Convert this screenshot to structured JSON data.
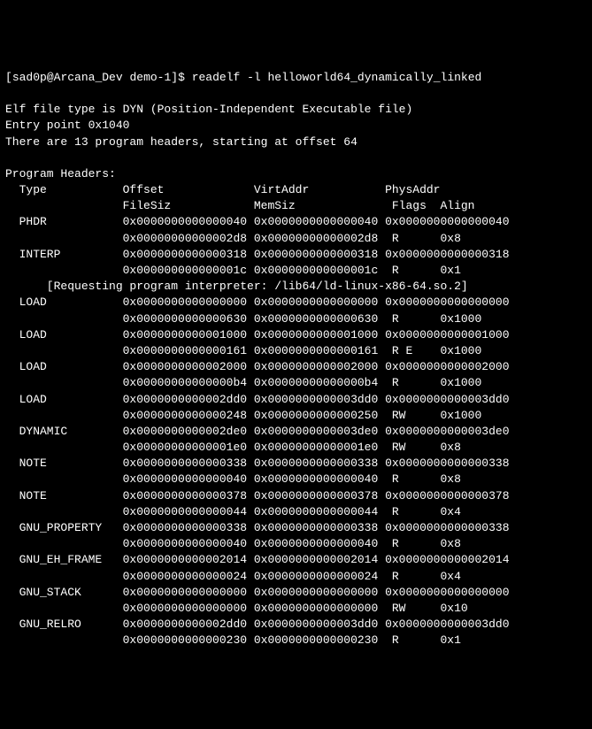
{
  "prompt": {
    "user": "sad0p",
    "host": "Arcana_Dev",
    "cwd": "demo-1",
    "command": "readelf -l helloworld64_dynamically_linked"
  },
  "header": {
    "filetype": "Elf file type is DYN (Position-Independent Executable file)",
    "entrypoint": "Entry point 0x1040",
    "count": "There are 13 program headers, starting at offset 64"
  },
  "section_title": "Program Headers:",
  "columns": {
    "type": "Type",
    "offset": "Offset",
    "virtaddr": "VirtAddr",
    "physaddr": "PhysAddr",
    "filesiz": "FileSiz",
    "memsiz": "MemSiz",
    "flags": "Flags",
    "align": "Align"
  },
  "interpreter_note": "[Requesting program interpreter: /lib64/ld-linux-x86-64.so.2]",
  "rows": [
    {
      "type": "PHDR",
      "offset": "0x0000000000000040",
      "virtaddr": "0x0000000000000040",
      "physaddr": "0x0000000000000040",
      "filesiz": "0x00000000000002d8",
      "memsiz": "0x00000000000002d8",
      "flags": "R",
      "align": "0x8"
    },
    {
      "type": "INTERP",
      "offset": "0x0000000000000318",
      "virtaddr": "0x0000000000000318",
      "physaddr": "0x0000000000000318",
      "filesiz": "0x000000000000001c",
      "memsiz": "0x000000000000001c",
      "flags": "R",
      "align": "0x1"
    },
    {
      "type": "LOAD",
      "offset": "0x0000000000000000",
      "virtaddr": "0x0000000000000000",
      "physaddr": "0x0000000000000000",
      "filesiz": "0x0000000000000630",
      "memsiz": "0x0000000000000630",
      "flags": "R",
      "align": "0x1000"
    },
    {
      "type": "LOAD",
      "offset": "0x0000000000001000",
      "virtaddr": "0x0000000000001000",
      "physaddr": "0x0000000000001000",
      "filesiz": "0x0000000000000161",
      "memsiz": "0x0000000000000161",
      "flags": "R E",
      "align": "0x1000"
    },
    {
      "type": "LOAD",
      "offset": "0x0000000000002000",
      "virtaddr": "0x0000000000002000",
      "physaddr": "0x0000000000002000",
      "filesiz": "0x00000000000000b4",
      "memsiz": "0x00000000000000b4",
      "flags": "R",
      "align": "0x1000"
    },
    {
      "type": "LOAD",
      "offset": "0x0000000000002dd0",
      "virtaddr": "0x0000000000003dd0",
      "physaddr": "0x0000000000003dd0",
      "filesiz": "0x0000000000000248",
      "memsiz": "0x0000000000000250",
      "flags": "RW",
      "align": "0x1000"
    },
    {
      "type": "DYNAMIC",
      "offset": "0x0000000000002de0",
      "virtaddr": "0x0000000000003de0",
      "physaddr": "0x0000000000003de0",
      "filesiz": "0x00000000000001e0",
      "memsiz": "0x00000000000001e0",
      "flags": "RW",
      "align": "0x8"
    },
    {
      "type": "NOTE",
      "offset": "0x0000000000000338",
      "virtaddr": "0x0000000000000338",
      "physaddr": "0x0000000000000338",
      "filesiz": "0x0000000000000040",
      "memsiz": "0x0000000000000040",
      "flags": "R",
      "align": "0x8"
    },
    {
      "type": "NOTE",
      "offset": "0x0000000000000378",
      "virtaddr": "0x0000000000000378",
      "physaddr": "0x0000000000000378",
      "filesiz": "0x0000000000000044",
      "memsiz": "0x0000000000000044",
      "flags": "R",
      "align": "0x4"
    },
    {
      "type": "GNU_PROPERTY",
      "offset": "0x0000000000000338",
      "virtaddr": "0x0000000000000338",
      "physaddr": "0x0000000000000338",
      "filesiz": "0x0000000000000040",
      "memsiz": "0x0000000000000040",
      "flags": "R",
      "align": "0x8"
    },
    {
      "type": "GNU_EH_FRAME",
      "offset": "0x0000000000002014",
      "virtaddr": "0x0000000000002014",
      "physaddr": "0x0000000000002014",
      "filesiz": "0x0000000000000024",
      "memsiz": "0x0000000000000024",
      "flags": "R",
      "align": "0x4"
    },
    {
      "type": "GNU_STACK",
      "offset": "0x0000000000000000",
      "virtaddr": "0x0000000000000000",
      "physaddr": "0x0000000000000000",
      "filesiz": "0x0000000000000000",
      "memsiz": "0x0000000000000000",
      "flags": "RW",
      "align": "0x10"
    },
    {
      "type": "GNU_RELRO",
      "offset": "0x0000000000002dd0",
      "virtaddr": "0x0000000000003dd0",
      "physaddr": "0x0000000000003dd0",
      "filesiz": "0x0000000000000230",
      "memsiz": "0x0000000000000230",
      "flags": "R",
      "align": "0x1"
    }
  ]
}
